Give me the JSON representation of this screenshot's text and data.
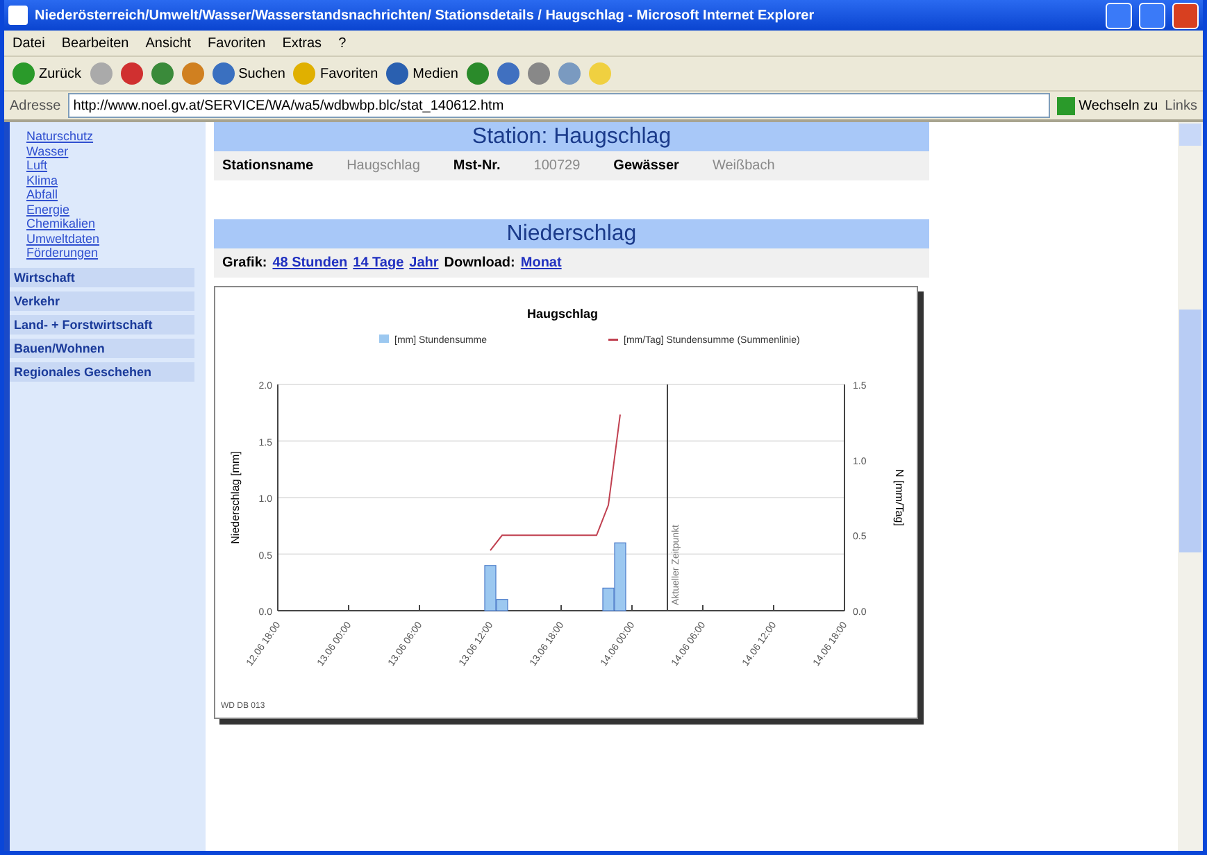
{
  "window": {
    "title": "Niederösterreich/Umwelt/Wasser/Wasserstandsnachrichten/ Stationsdetails / Haugschlag - Microsoft Internet Explorer"
  },
  "menu": [
    "Datei",
    "Bearbeiten",
    "Ansicht",
    "Favoriten",
    "Extras",
    "?"
  ],
  "toolbar": [
    {
      "kind": "back",
      "label": "Zurück"
    },
    {
      "kind": "forward"
    },
    {
      "kind": "stop"
    },
    {
      "kind": "refresh"
    },
    {
      "kind": "home"
    },
    {
      "kind": "search",
      "label": "Suchen"
    },
    {
      "kind": "favorites",
      "label": "Favoriten"
    },
    {
      "kind": "media",
      "label": "Medien"
    },
    {
      "kind": "history"
    },
    {
      "kind": "mail"
    },
    {
      "kind": "print"
    },
    {
      "kind": "edit"
    },
    {
      "kind": "folder"
    }
  ],
  "address": {
    "label": "Adresse",
    "value": "http://www.noel.gv.at/SERVICE/WA/wa5/wdbwbp.blc/stat_140612.htm",
    "go": "Wechseln zu",
    "links": "Links"
  },
  "sidebar": {
    "links": [
      "Naturschutz",
      "Wasser",
      "Luft",
      "Klima",
      "Abfall",
      "Energie",
      "Chemikalien",
      "Umweltdaten",
      "Förderungen"
    ],
    "sections": [
      "Wirtschaft",
      "Verkehr",
      "Land- + Forstwirtschaft",
      "Bauen/Wohnen",
      "Regionales Geschehen"
    ]
  },
  "station": {
    "title": "Station: Haugschlag",
    "fields": [
      {
        "label": "Stationsname",
        "value": "Haugschlag"
      },
      {
        "label": "Mst-Nr.",
        "value": "100729"
      },
      {
        "label": "Gewässer",
        "value": "Weißbach"
      }
    ]
  },
  "precipitation": {
    "title": "Niederschlag",
    "graphic_label": "Grafik:",
    "graphic_links": [
      "48 Stunden",
      "14 Tage",
      "Jahr"
    ],
    "download_label": "Download:",
    "download_links": [
      "Monat"
    ],
    "chart_data": {
      "type": "bar",
      "title": "Haugschlag",
      "ylabel": "Niederschlag [mm]",
      "y2label": "N [mm/Tag]",
      "categories": [
        "12.06 18:00",
        null,
        null,
        null,
        null,
        null,
        "13.06 00:00",
        null,
        null,
        null,
        null,
        null,
        "13.06 06:00",
        null,
        null,
        null,
        null,
        null,
        "13.06 12:00",
        null,
        null,
        null,
        null,
        null,
        "13.06 18:00",
        null,
        null,
        null,
        null,
        null,
        "14.06 00:00",
        null,
        null,
        null,
        null,
        null,
        "14.06 06:00",
        null,
        null,
        null,
        null,
        null,
        "14.06 12:00",
        null,
        null,
        null,
        null,
        null,
        "14.06 18:00"
      ],
      "ylim": [
        0,
        2
      ],
      "y2lim": [
        0,
        1.5
      ],
      "series": [
        {
          "name": "[mm] Stundensumme",
          "color": "#9cc8f0",
          "values": [
            null,
            null,
            null,
            null,
            null,
            null,
            null,
            null,
            null,
            null,
            null,
            null,
            null,
            null,
            null,
            null,
            null,
            null,
            0.4,
            0.1,
            null,
            null,
            null,
            null,
            null,
            null,
            null,
            null,
            0.2,
            0.6,
            null,
            null,
            null,
            null,
            null,
            null,
            null,
            null,
            null,
            null,
            null,
            null,
            null,
            null,
            null,
            null,
            null,
            null,
            null
          ]
        },
        {
          "name": "[mm/Tag] Stundensumme (Summenlinie)",
          "color": "#c04050",
          "type": "line",
          "axis": "y2",
          "values": [
            null,
            null,
            null,
            null,
            null,
            null,
            null,
            null,
            null,
            null,
            null,
            null,
            null,
            null,
            null,
            null,
            null,
            null,
            0.4,
            0.5,
            0.5,
            0.5,
            0.5,
            0.5,
            0.5,
            0.5,
            0.5,
            0.5,
            0.7,
            1.3,
            null,
            null,
            null,
            null,
            null,
            null,
            null,
            null,
            null,
            null,
            null,
            null,
            null,
            null,
            null,
            null,
            null,
            null,
            null
          ]
        }
      ],
      "yticks": [
        {
          "value": 0,
          "label": "0.0"
        },
        {
          "value": 0.5,
          "label": "0.5"
        },
        {
          "value": 1,
          "label": "1.0"
        },
        {
          "value": 1.5,
          "label": "1.5"
        },
        {
          "value": 2,
          "label": "2.0"
        }
      ],
      "y2ticks": [
        {
          "value": 0,
          "label": "0.0"
        },
        {
          "value": 0.5,
          "label": "0.5"
        },
        {
          "value": 1,
          "label": "1.0"
        },
        {
          "value": 1.5,
          "label": "1.5"
        }
      ],
      "annotations": [
        "Aktueller Zeitpunkt"
      ],
      "grid": true,
      "legend": "top"
    },
    "chart_footer": "WD DB 013"
  }
}
